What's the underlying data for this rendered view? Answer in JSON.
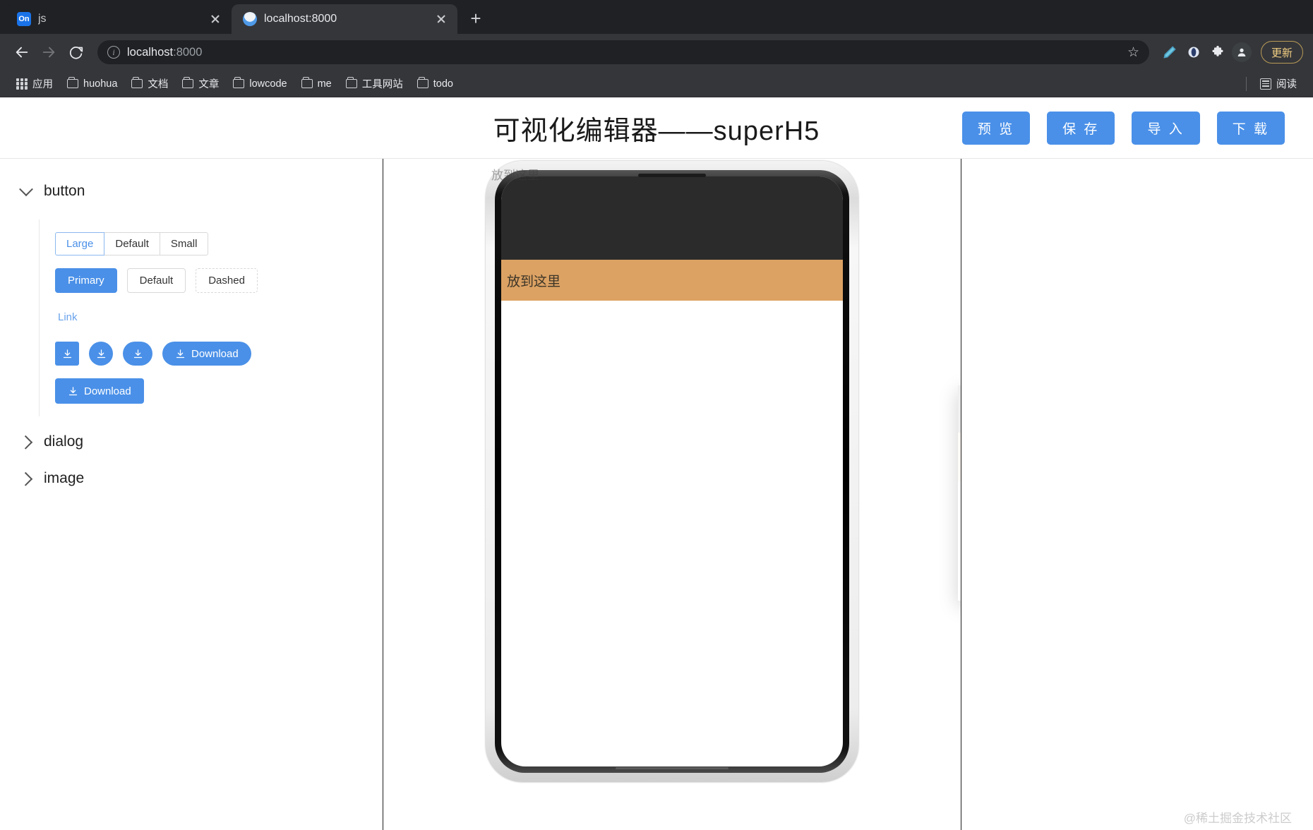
{
  "browser": {
    "tabs": [
      {
        "title": "js",
        "favicon": "on-badge-icon",
        "active": false
      },
      {
        "title": "localhost:8000",
        "favicon": "globe-favicon-icon",
        "active": true
      }
    ],
    "new_tab_label": "+",
    "omnibox": {
      "url_host": "localhost",
      "url_port": ":8000",
      "full_url": "localhost:8000"
    },
    "update_button_label": "更新",
    "bookmarks": [
      {
        "label": "应用",
        "icon": "apps-grid-icon"
      },
      {
        "label": "huohua",
        "icon": "folder-icon"
      },
      {
        "label": "文档",
        "icon": "folder-icon"
      },
      {
        "label": "文章",
        "icon": "folder-icon"
      },
      {
        "label": "lowcode",
        "icon": "folder-icon"
      },
      {
        "label": "me",
        "icon": "folder-icon"
      },
      {
        "label": "工具网站",
        "icon": "folder-icon"
      },
      {
        "label": "todo",
        "icon": "folder-icon"
      }
    ],
    "reading_list_label": "阅读"
  },
  "app": {
    "title": "可视化编辑器——superH5",
    "actions": [
      {
        "label": "预 览",
        "name": "preview-button"
      },
      {
        "label": "保 存",
        "name": "save-button"
      },
      {
        "label": "导 入",
        "name": "import-button"
      },
      {
        "label": "下 载",
        "name": "download-button"
      }
    ],
    "accent_color": "#4a90e8"
  },
  "sidebar": {
    "sections": [
      {
        "label": "button",
        "expanded": true
      },
      {
        "label": "dialog",
        "expanded": false
      },
      {
        "label": "image",
        "expanded": false
      }
    ]
  },
  "button_demo": {
    "size_group": {
      "options": [
        "Large",
        "Default",
        "Small"
      ],
      "selected": "Large"
    },
    "type_group": [
      {
        "label": "Primary",
        "variant": "primary"
      },
      {
        "label": "Default",
        "variant": "default"
      },
      {
        "label": "Dashed",
        "variant": "dashed"
      }
    ],
    "link_label": "Link",
    "icon_buttons": [
      {
        "shape": "square",
        "icon": "download-icon",
        "label": ""
      },
      {
        "shape": "circle",
        "icon": "download-icon",
        "label": ""
      },
      {
        "shape": "round",
        "icon": "download-icon",
        "label": ""
      },
      {
        "shape": "pill",
        "icon": "download-icon",
        "label": "Download"
      }
    ],
    "download_button_label": "Download"
  },
  "canvas": {
    "dropzone_label": "放到这里",
    "ghost_label": "放到这里"
  },
  "watermark": "@稀土掘金技术社区"
}
